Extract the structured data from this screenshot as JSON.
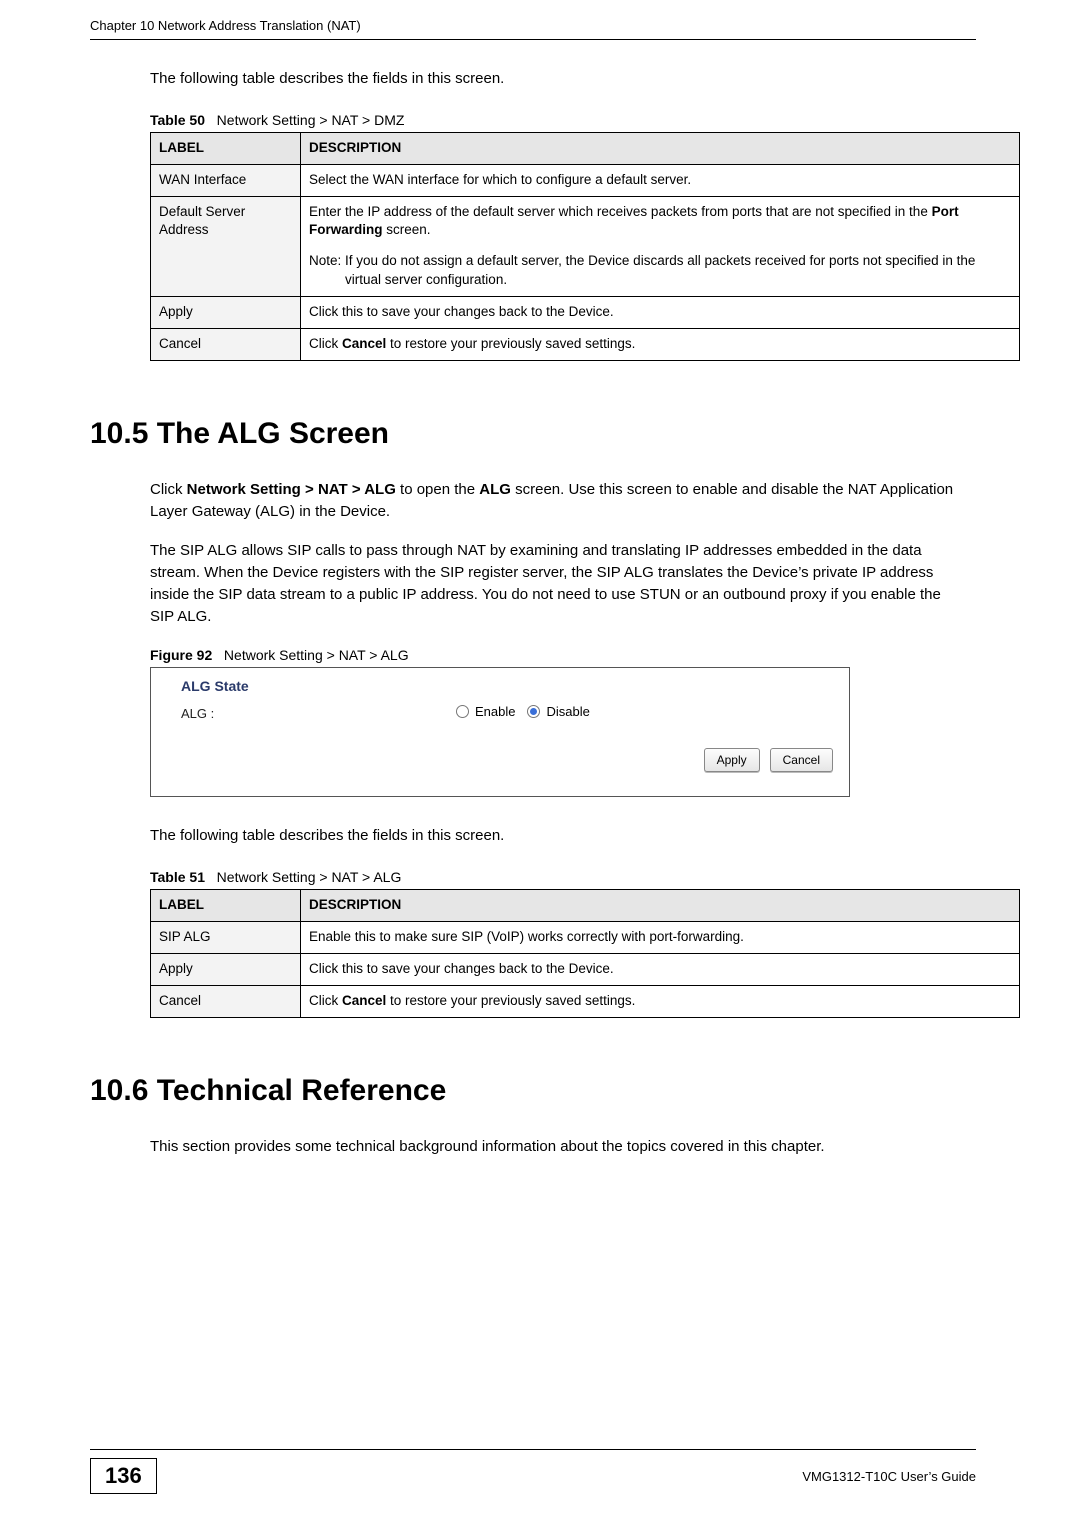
{
  "header": {
    "chapter_line": "Chapter 10 Network Address Translation (NAT)"
  },
  "intro_line": "The following table describes the fields in this screen.",
  "table50": {
    "caption_num": "Table 50",
    "caption_text": "Network Setting > NAT > DMZ",
    "head_label": "LABEL",
    "head_desc": "DESCRIPTION",
    "rows": [
      {
        "label": "WAN Interface",
        "desc": "Select the WAN interface for which to configure a default server."
      },
      {
        "label": "Default Server Address",
        "desc_main": "Enter the IP address of the default server which receives packets from ports that are not specified in the ",
        "desc_bold": "Port Forwarding",
        "desc_tail": " screen.",
        "note": "Note: If you do not assign a default server, the Device discards all packets received for ports not specified in the virtual server configuration."
      },
      {
        "label": "Apply",
        "desc": "Click this to save your changes back to the Device."
      },
      {
        "label": "Cancel",
        "desc_pre": "Click ",
        "desc_bold": "Cancel",
        "desc_post": " to restore your previously saved settings."
      }
    ]
  },
  "section105": {
    "heading": "10.5  The ALG Screen",
    "para1_pre": "Click ",
    "para1_bold1": "Network Setting > NAT > ALG",
    "para1_mid1": " to open the ",
    "para1_bold2": "ALG",
    "para1_post": " screen. Use this screen to enable and disable the NAT Application Layer Gateway (ALG) in the Device.",
    "para2": "The SIP ALG allows SIP calls to pass through NAT by examining and translating IP addresses embedded in the data stream. When the Device registers with the SIP register server, the SIP ALG translates the Device’s private IP address inside the SIP data stream to a public IP address. You do not need to use STUN or an outbound proxy if you enable the SIP ALG."
  },
  "figure92": {
    "caption_num": "Figure 92",
    "caption_text": "Network Setting > NAT > ALG",
    "state_label": "ALG State",
    "alg_label": "ALG :",
    "enable_label": "Enable",
    "disable_label": "Disable",
    "apply_label": "Apply",
    "cancel_label": "Cancel"
  },
  "intro_line2": "The following table describes the fields in this screen.",
  "table51": {
    "caption_num": "Table 51",
    "caption_text": "Network Setting > NAT > ALG",
    "head_label": "LABEL",
    "head_desc": "DESCRIPTION",
    "rows": [
      {
        "label": "SIP ALG",
        "desc": "Enable this to make sure SIP (VoIP) works correctly with port-forwarding."
      },
      {
        "label": "Apply",
        "desc": "Click this to save your changes back to the Device."
      },
      {
        "label": "Cancel",
        "desc_pre": "Click ",
        "desc_bold": "Cancel",
        "desc_post": " to restore your previously saved settings."
      }
    ]
  },
  "section106": {
    "heading": "10.6  Technical Reference",
    "para": "This section provides some technical background information about the topics covered in this chapter."
  },
  "footer": {
    "page_number": "136",
    "guide": "VMG1312-T10C User’s Guide"
  }
}
